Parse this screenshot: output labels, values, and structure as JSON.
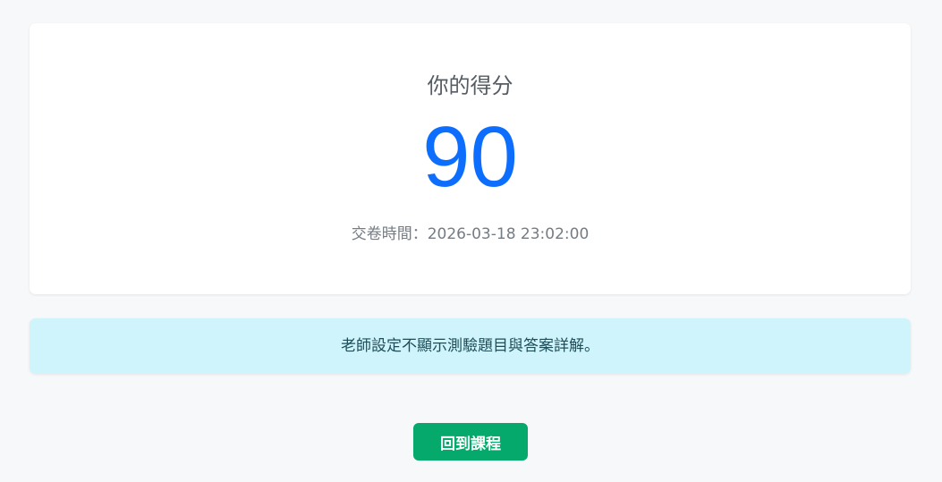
{
  "result": {
    "title": "你的得分",
    "score": "90",
    "submit_time": "交卷時間：2026-03-18 23:02:00"
  },
  "notice": {
    "text": "老師設定不顯示測驗題目與答案詳解。"
  },
  "actions": {
    "back_label": "回到課程"
  },
  "colors": {
    "score": "#0d6efd",
    "notice_bg": "#cff4fc",
    "button_bg": "#05a96b",
    "page_bg": "#f7f8fa"
  }
}
